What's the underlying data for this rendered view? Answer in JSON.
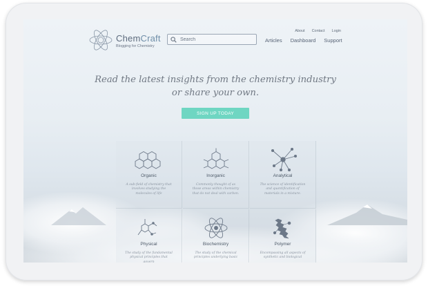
{
  "brand": {
    "name_a": "Chem",
    "name_b": "Craft",
    "tagline": "Blogging for Chemistry"
  },
  "search": {
    "placeholder": "Search"
  },
  "top_links": [
    "About",
    "Contact",
    "Login"
  ],
  "nav": [
    "Articles",
    "Dashboard",
    "Support"
  ],
  "hero": {
    "line1": "Read the latest insights from the chemistry industry",
    "line2": "or share your own.",
    "cta": "SIGN UP TODAY"
  },
  "categories": [
    {
      "title": "Organic",
      "desc": "A sub-field of chemistry that involves studying the molecules of life",
      "icon": "hexagon-rings-icon"
    },
    {
      "title": "Inorganic",
      "desc": "Commonly thought of as those areas within chemistry that do not deal with carbon.",
      "icon": "hexagon-molecule-icon"
    },
    {
      "title": "Analytical",
      "desc": "The science of identification and quantification of materials in a mixture.",
      "icon": "network-node-icon"
    },
    {
      "title": "Physical",
      "desc": "The study of the fundamental physical principles that govern",
      "icon": "molecule-structure-icon"
    },
    {
      "title": "Biochemistry",
      "desc": "The study of the chemical principles underlying basic",
      "icon": "atom-icon"
    },
    {
      "title": "Polymer",
      "desc": "Encompassing all aspects of synthetic and biological",
      "icon": "polymer-chain-icon"
    }
  ],
  "colors": {
    "accent": "#6fd6c2",
    "text": "#4e5a68",
    "brand": "#6f8ea8"
  }
}
